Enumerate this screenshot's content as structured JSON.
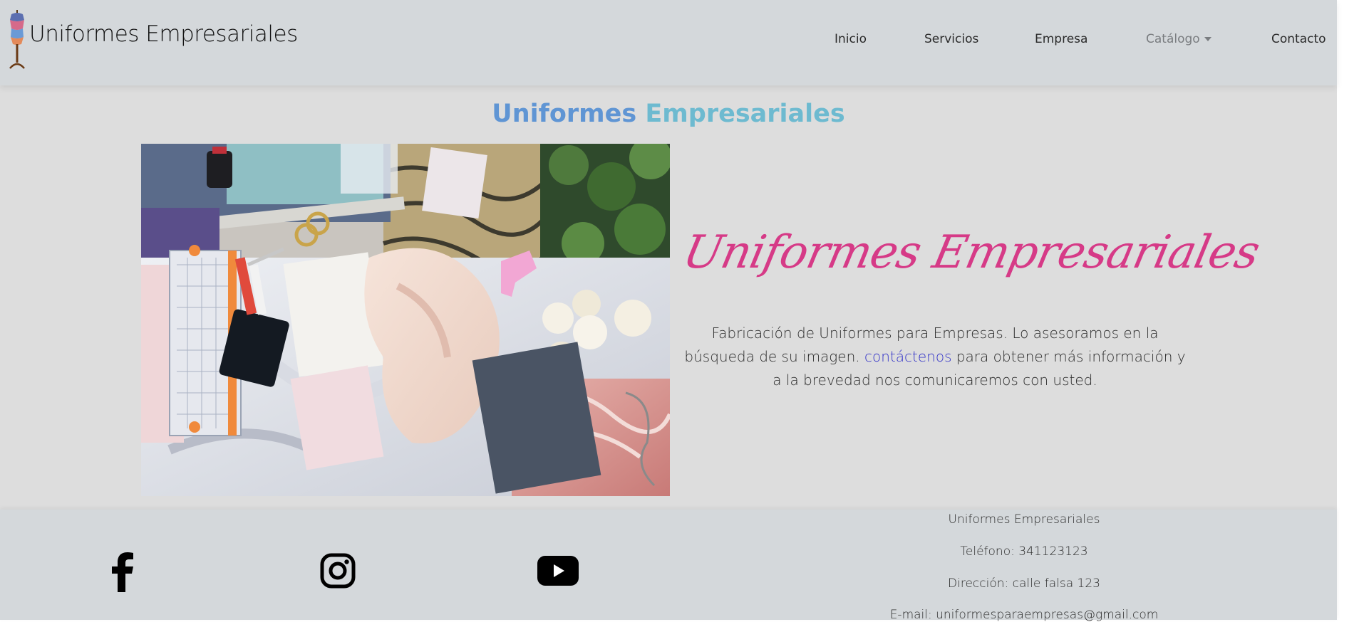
{
  "navbar": {
    "brand": "Uniformes Empresariales",
    "links": [
      {
        "label": "Inicio"
      },
      {
        "label": "Servicios"
      },
      {
        "label": "Empresa"
      },
      {
        "label": "Catálogo"
      },
      {
        "label": "Contacto"
      }
    ]
  },
  "hero": {
    "title_word1": "Uniformes",
    "title_word2": "Empresariales",
    "script_title": "Uniformes Empresariales",
    "intro_before": "Fabricación de Uniformes para Empresas. Lo asesoramos en la búsqueda de su imagen.",
    "intro_link": "contáctenos",
    "intro_after": "para obtener más información y a la brevedad nos comunicaremos con usted."
  },
  "footer": {
    "social": [
      "facebook-icon",
      "instagram-icon",
      "youtube-icon"
    ],
    "company": "Uniformes Empresariales",
    "phone": "Teléfono: 341123123",
    "address": "Dirección: calle falsa 123",
    "email": "E-mail: uniformesparaempresas@gmail.com"
  },
  "colors": {
    "page_bg": "#dddddd",
    "bar_bg": "#d4d8db",
    "script_title": "#d63a87",
    "link": "#3434c8",
    "title_blue": "#5f95d4",
    "title_teal": "#6dbad0"
  }
}
